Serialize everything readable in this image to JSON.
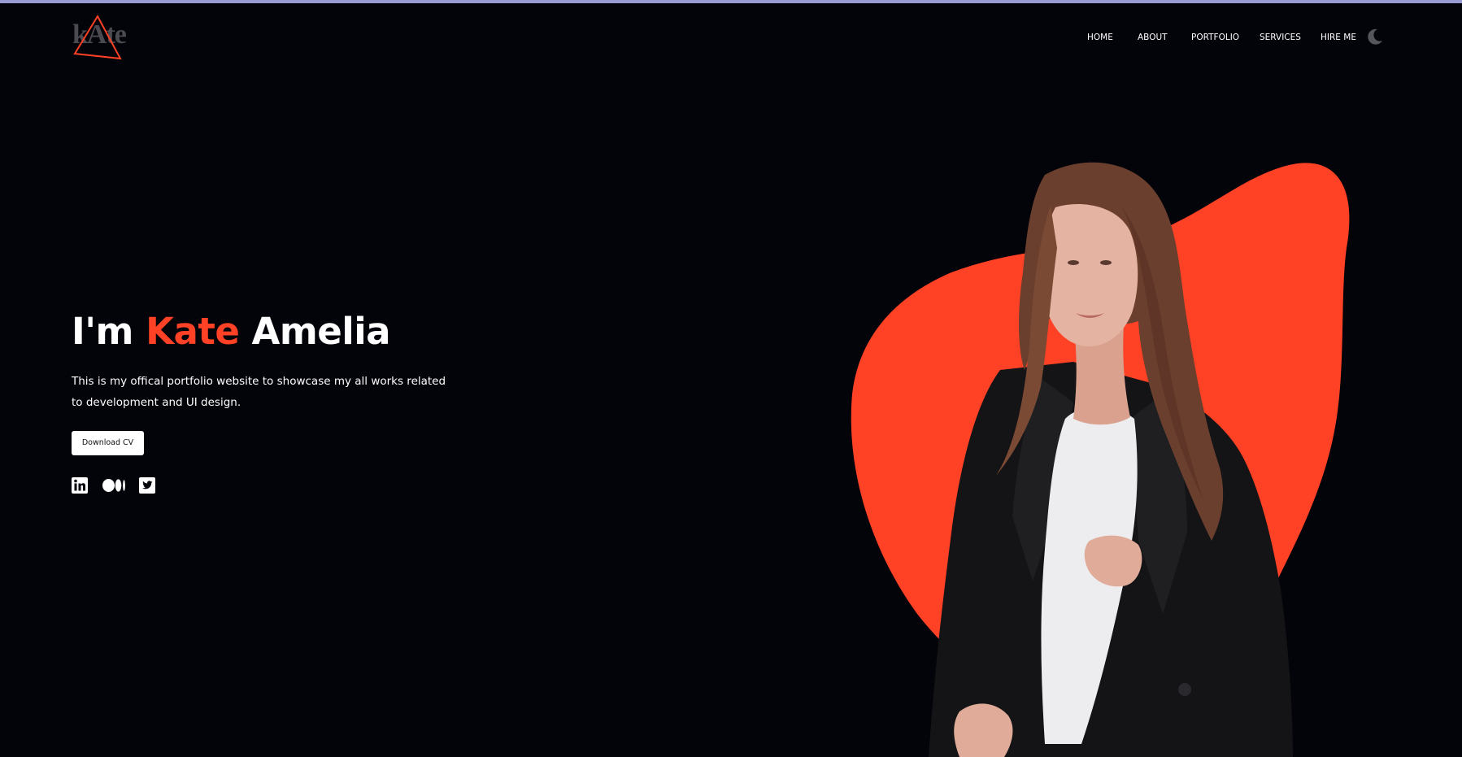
{
  "logo": {
    "text": "kAte"
  },
  "nav": {
    "items": [
      {
        "label": "HOME"
      },
      {
        "label": "ABOUT"
      },
      {
        "label": "PORTFOLIO"
      },
      {
        "label": "SERVICES"
      },
      {
        "label": "HIRE ME"
      }
    ],
    "theme_toggle_icon": "moon-icon"
  },
  "hero": {
    "title_prefix": "I'm",
    "title_first_name": "Kate",
    "title_last_name": "Amelia",
    "description": "This is my offical portfolio website to showcase my all works related to development and UI design.",
    "button_label": "Download CV",
    "socials": [
      {
        "icon": "linkedin-icon"
      },
      {
        "icon": "medium-icon"
      },
      {
        "icon": "twitter-icon"
      }
    ],
    "image_icon": "portrait-photo"
  },
  "colors": {
    "background": "#03030a",
    "accent": "#ff4125",
    "top_border": "#9a9bd2",
    "text": "#ffffff"
  }
}
